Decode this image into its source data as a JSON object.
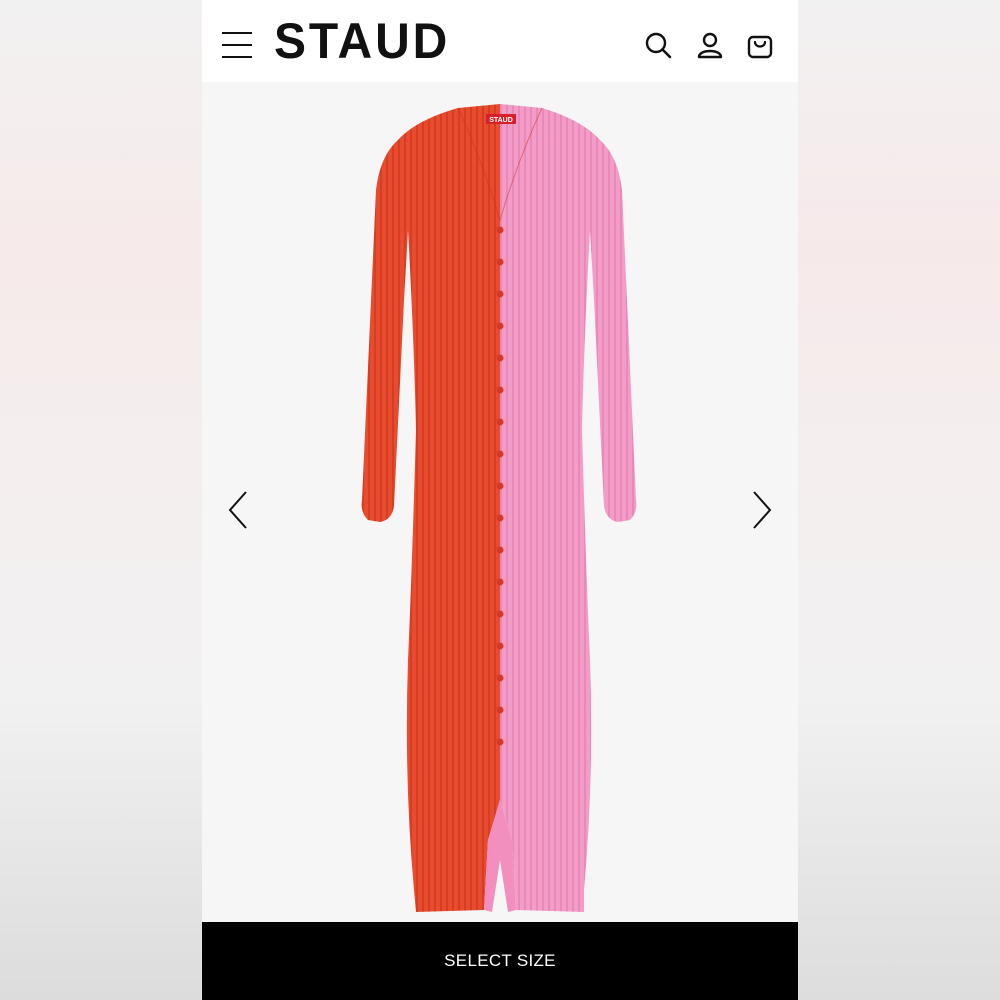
{
  "header": {
    "brand": "STAUD",
    "icons": [
      "hamburger-menu-icon",
      "search-icon",
      "account-icon",
      "shopping-bag-icon"
    ]
  },
  "product": {
    "image": "two-tone ribbed knit button-front midi cardigan dress, red-orange left half, pink right half",
    "label_tag": "STAUD",
    "colors": {
      "left": "#e84a2e",
      "right": "#f39ac6"
    }
  },
  "gallery": {
    "icons": [
      "chevron-left-icon",
      "chevron-right-icon"
    ]
  },
  "cta": {
    "label": "SELECT SIZE"
  },
  "colors": {
    "header_bg": "#ffffff",
    "gallery_bg": "#f6f6f6",
    "cta_bg": "#000000",
    "cta_text": "#ffffff"
  }
}
